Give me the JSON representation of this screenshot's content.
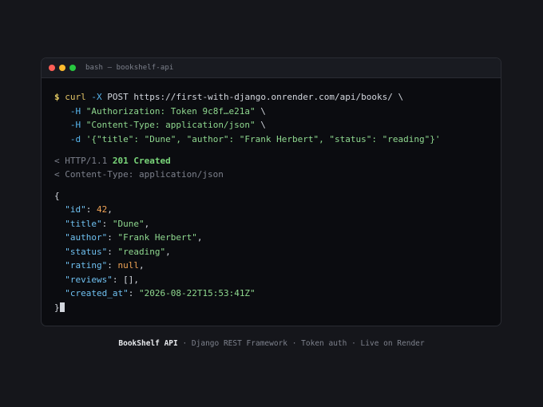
{
  "window": {
    "title": "bash — bookshelf-api"
  },
  "command": {
    "prompt": "$",
    "cmd": "curl",
    "method_flag": "-X",
    "method": "POST",
    "url": "https://first-with-django.onrender.com/api/books/",
    "continuation": "\\",
    "headers": [
      {
        "flag": "-H",
        "value": "\"Authorization: Token 9c8f…e21a\""
      },
      {
        "flag": "-H",
        "value": "\"Content-Type: application/json\""
      }
    ],
    "data_flag": "-d",
    "data_value": "'{\"title\": \"Dune\", \"author\": \"Frank Herbert\", \"status\": \"reading\"}'"
  },
  "response": {
    "status_prefix": "< HTTP/1.1",
    "status_code": "201 Created",
    "content_type": "< Content-Type: application/json",
    "open_brace": "{",
    "close_brace": "}",
    "fields": [
      {
        "key": "\"id\"",
        "value": "42",
        "type": "number"
      },
      {
        "key": "\"title\"",
        "value": "\"Dune\"",
        "type": "string"
      },
      {
        "key": "\"author\"",
        "value": "\"Frank Herbert\"",
        "type": "string"
      },
      {
        "key": "\"status\"",
        "value": "\"reading\"",
        "type": "string"
      },
      {
        "key": "\"rating\"",
        "value": "null",
        "type": "null"
      },
      {
        "key": "\"reviews\"",
        "value": "[]",
        "type": "plain"
      },
      {
        "key": "\"created_at\"",
        "value": "\"2026-08-22T15:53:41Z\"",
        "type": "string"
      }
    ]
  },
  "footer": {
    "brand": "BookShelf API",
    "rest": " · Django REST Framework · Token auth · Live on Render"
  },
  "colors": {
    "background": "#15161b",
    "terminal": "#0b0c10",
    "string": "#8fd88f",
    "key": "#6fc0f0",
    "number": "#f0a456",
    "prompt": "#e0c862"
  }
}
